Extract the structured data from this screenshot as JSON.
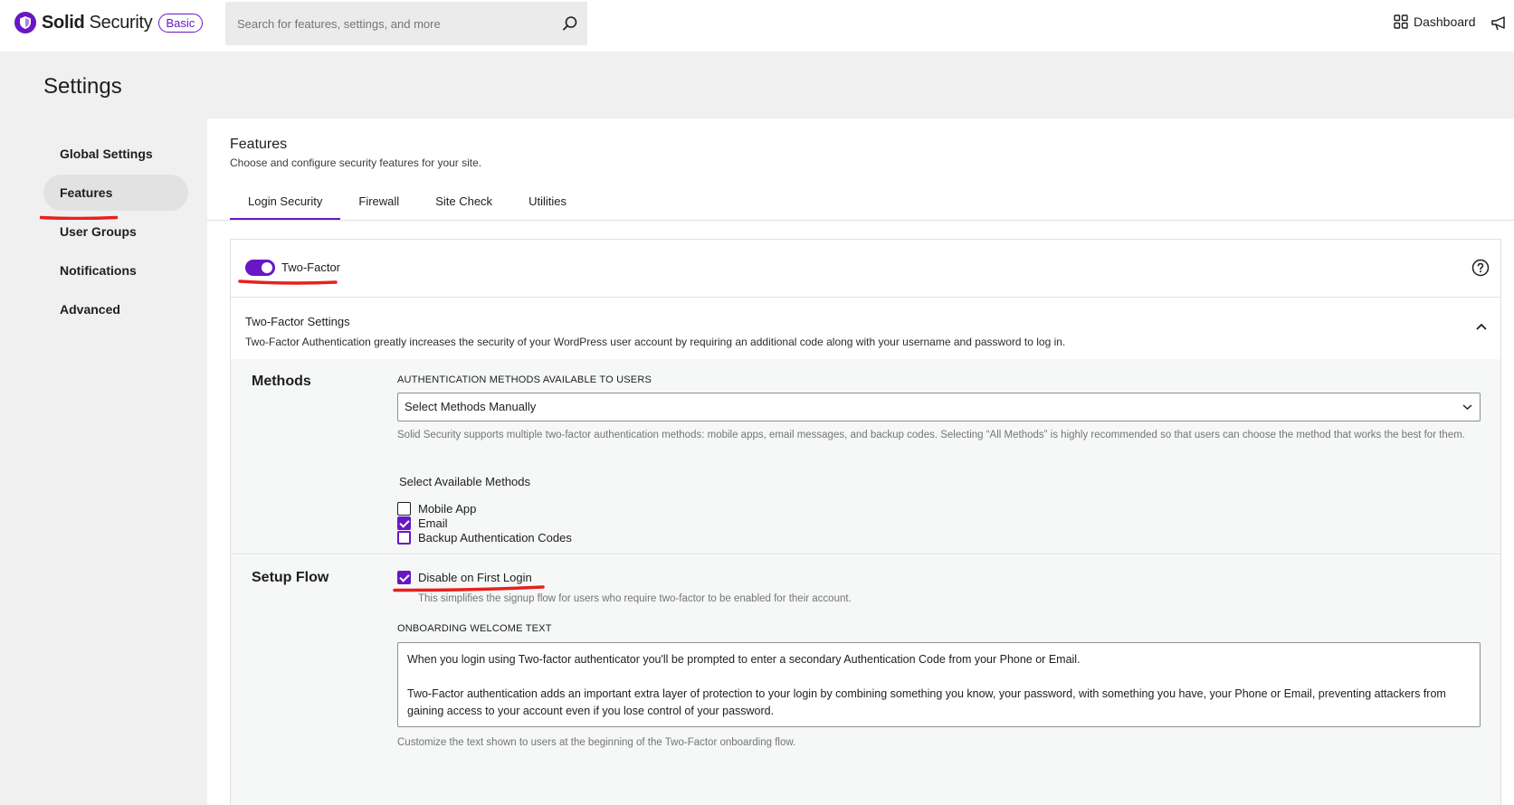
{
  "app": {
    "brand_bold": "Solid",
    "brand_light": " Security",
    "badge": "Basic",
    "brand_color": "#6817c5"
  },
  "search": {
    "placeholder": "Search for features, settings, and more",
    "icon": "search-icon"
  },
  "header": {
    "dashboard_label": "Dashboard",
    "dashboard_icon": "grid-icon",
    "notifications_icon": "megaphone-icon"
  },
  "page": {
    "title": "Settings"
  },
  "sidebar": {
    "items": [
      {
        "label": "Global Settings",
        "active": false
      },
      {
        "label": "Features",
        "active": true
      },
      {
        "label": "User Groups",
        "active": false
      },
      {
        "label": "Notifications",
        "active": false
      },
      {
        "label": "Advanced",
        "active": false
      }
    ]
  },
  "main": {
    "title": "Features",
    "subtitle": "Choose and configure security features for your site.",
    "tabs": [
      {
        "label": "Login Security",
        "active": true
      },
      {
        "label": "Firewall",
        "active": false
      },
      {
        "label": "Site Check",
        "active": false
      },
      {
        "label": "Utilities",
        "active": false
      }
    ]
  },
  "two_factor": {
    "toggle_label": "Two-Factor",
    "enabled": true,
    "settings_title": "Two-Factor Settings",
    "settings_desc": "Two-Factor Authentication greatly increases the security of your WordPress user account by requiring an additional code along with your username and password to log in.",
    "methods": {
      "section_label": "Methods",
      "field_label": "AUTHENTICATION METHODS AVAILABLE TO USERS",
      "selected_value": "Select Methods Manually",
      "help": "Solid Security supports multiple two-factor authentication methods: mobile apps, email messages, and backup codes. Selecting “All Methods” is highly recommended so that users can choose the method that works the best for them.",
      "available_label": "Select Available Methods",
      "options": [
        {
          "label": "Mobile App",
          "checked": false
        },
        {
          "label": "Email",
          "checked": true
        },
        {
          "label": "Backup Authentication Codes",
          "checked": false
        }
      ]
    },
    "setup": {
      "section_label": "Setup Flow",
      "disable_first_login_label": "Disable on First Login",
      "disable_first_login_checked": true,
      "disable_help": "This simplifies the signup flow for users who require two-factor to be enabled for their account.",
      "onboarding_label": "ONBOARDING WELCOME TEXT",
      "onboarding_text": "When you login using Two-factor authenticator you'll be prompted to enter a secondary Authentication Code from your Phone or Email.\n\nTwo-Factor authentication adds an important extra layer of protection to your login by combining something you know, your password, with something you have, your Phone or Email, preventing attackers from gaining access to your account even if you lose control of your password.",
      "onboarding_help": "Customize the text shown to users at the beginning of the Two-Factor onboarding flow."
    }
  }
}
